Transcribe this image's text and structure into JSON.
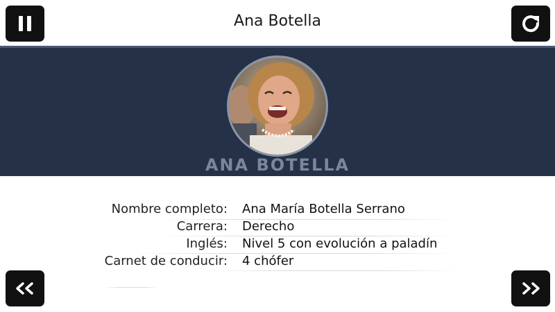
{
  "header": {
    "title": "Ana Botella"
  },
  "profile": {
    "banner_name": "ANA BOTELLA"
  },
  "details": [
    {
      "label": "Nombre completo:",
      "value": "Ana María Botella Serrano"
    },
    {
      "label": "Carrera:",
      "value": "Derecho"
    },
    {
      "label": "Inglés:",
      "value": "Nivel 5 con evolución a paladín"
    },
    {
      "label": "Carnet de conducir:",
      "value": "4 chófer"
    }
  ],
  "icons": {
    "pause": "pause-icon",
    "refresh": "refresh-icon",
    "previous": "double-chevron-left-icon",
    "next": "double-chevron-right-icon"
  },
  "colors": {
    "banner": "#243147",
    "button": "#111111",
    "banner_text": "#7a8699"
  }
}
